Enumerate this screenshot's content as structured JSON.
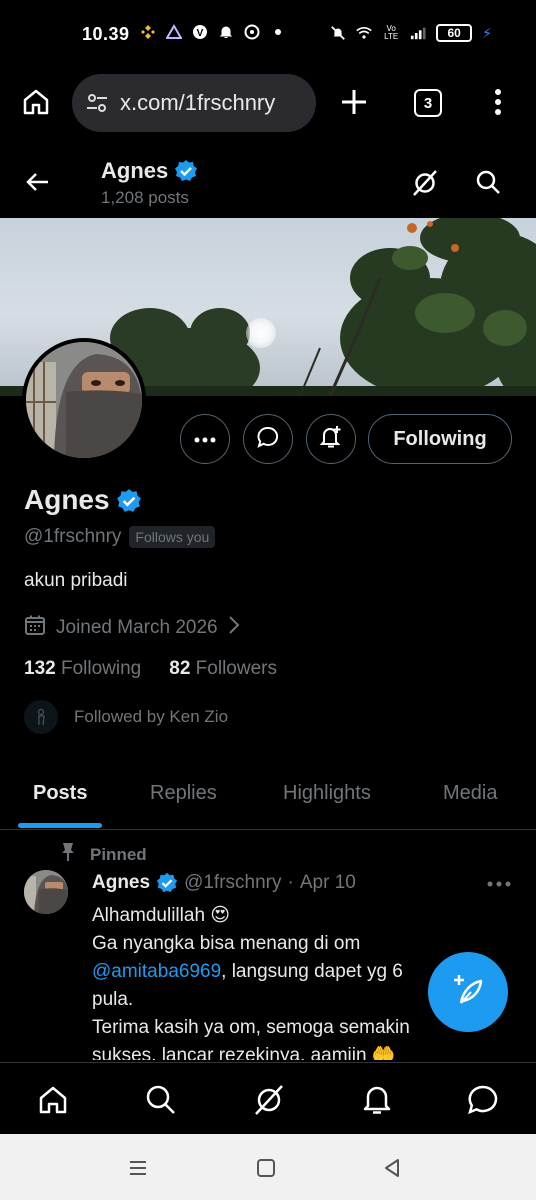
{
  "status_bar": {
    "time": "10.39",
    "battery": "60",
    "network": "Vo LTE"
  },
  "browser": {
    "url": "x.com/1frschnry",
    "tab_count": "3"
  },
  "header": {
    "name": "Agnes",
    "posts_count": "1,208 posts"
  },
  "profile": {
    "name": "Agnes",
    "handle": "@1frschnry",
    "follows_you": "Follows you",
    "bio": "akun pribadi",
    "joined": "Joined March 2026",
    "following_count": "132",
    "following_label": "Following",
    "followers_count": "82",
    "followers_label": "Followers",
    "followed_by": "Followed by Ken Zio",
    "follow_button": "Following"
  },
  "tabs": [
    "Posts",
    "Replies",
    "Highlights",
    "Media"
  ],
  "post": {
    "pinned_label": "Pinned",
    "name": "Agnes",
    "handle": "@1frschnry",
    "separator": "·",
    "date": "Apr 10",
    "line1": "Alhamdulillah 😍",
    "line2": "Ga nyangka bisa menang di om",
    "mention": "@amitaba6969",
    "line3_rest": ", langsung dapet yg 6",
    "line4": "pula.",
    "line5": "Terima kasih ya om, semoga semakin",
    "line6": "sukses, lancar rezekinya, aamiin 🤲"
  },
  "colors": {
    "accent": "#1d9bf0",
    "background": "#000000",
    "muted_text": "#71767b",
    "primary_text": "#e7e9ea"
  },
  "icons": {
    "top_bar": [
      "back-arrow-icon",
      "grok-icon",
      "search-icon"
    ],
    "actions": [
      "more-icon",
      "message-icon",
      "notification-bell-icon"
    ],
    "bottom_nav": [
      "home-icon",
      "search-icon",
      "grok-icon",
      "notifications-icon",
      "messages-icon"
    ],
    "system_nav": [
      "recent-apps-icon",
      "home-icon",
      "back-icon"
    ]
  }
}
